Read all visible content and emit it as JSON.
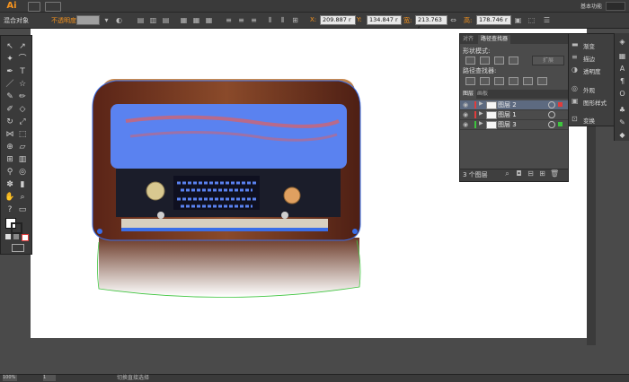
{
  "app": {
    "logo": "Ai",
    "workspace": "基本功能"
  },
  "control_bar": {
    "mixed_label": "混合对象",
    "opacity_label": "不透明度:",
    "x_label": "X:",
    "x_value": "209.887 r",
    "y_label": "Y:",
    "y_value": "134.847 r",
    "w_label": "宽:",
    "w_value": "213.763 r",
    "h_label": "高:",
    "h_value": "178.746 r"
  },
  "pathfinder_panel": {
    "tabs": [
      "对齐",
      "路径查找器"
    ],
    "shape_modes_label": "形状模式:",
    "expand_label": "扩展",
    "pathfinders_label": "路径查找器:"
  },
  "layers_panel": {
    "tabs": [
      "图层",
      "画板"
    ],
    "layers": [
      {
        "name": "图层 2",
        "color": "#e03c3c",
        "selected": true
      },
      {
        "name": "图层 1",
        "color": "#e03c3c",
        "selected": false
      },
      {
        "name": "图层 3",
        "color": "#3ec43e",
        "selected": false
      }
    ],
    "count_label": "3 个图层"
  },
  "props_panel": {
    "items": [
      {
        "label": "渐变",
        "icon": "gradient-icon"
      },
      {
        "label": "描边",
        "icon": "stroke-icon"
      },
      {
        "label": "透明度",
        "icon": "transparency-icon"
      },
      {
        "label": "外观",
        "icon": "appearance-icon"
      },
      {
        "label": "图形样式",
        "icon": "graphic-styles-icon"
      },
      {
        "label": "变换",
        "icon": "transform-icon"
      }
    ]
  },
  "status_bar": {
    "zoom": "100%",
    "page": "1",
    "text": "切换直接选择"
  },
  "colors": {
    "accent": "#f7941e",
    "selection_blue": "#3a6ee8",
    "guide_green": "#3ec43e"
  }
}
